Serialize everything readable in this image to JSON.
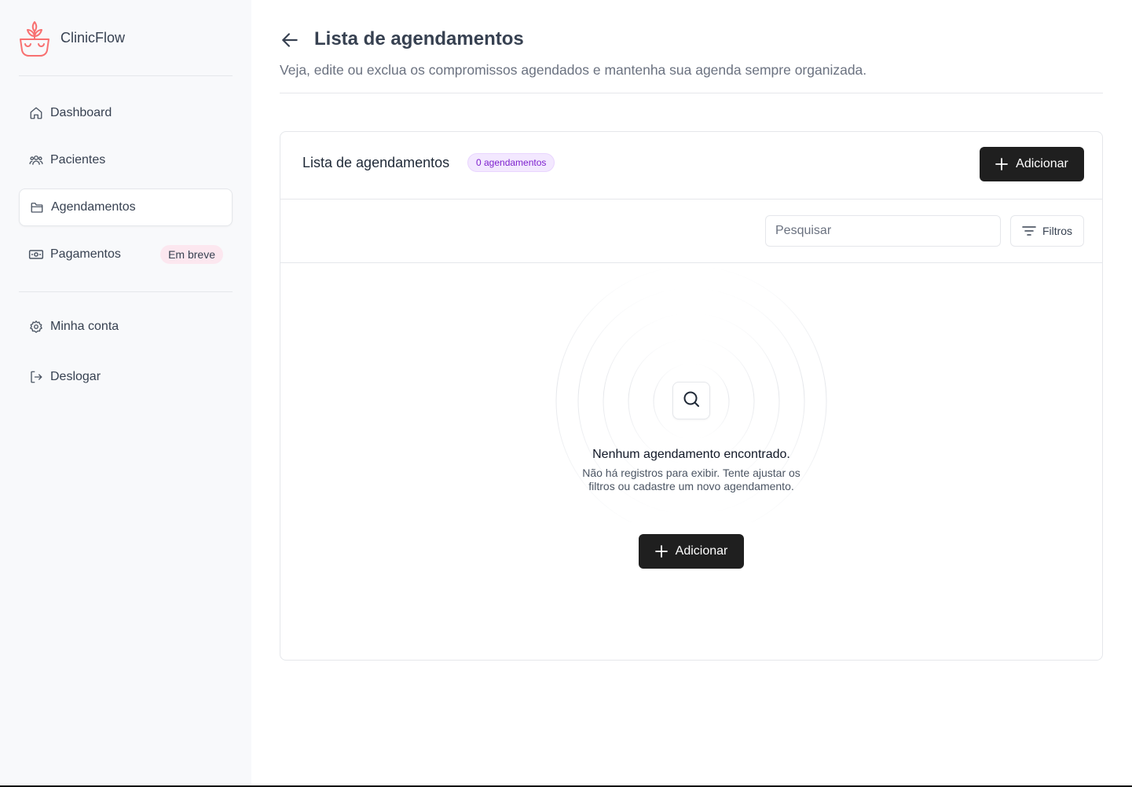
{
  "brand": {
    "name": "ClinicFlow",
    "accent": "#f87171"
  },
  "sidebar": {
    "items": [
      {
        "label": "Dashboard",
        "icon": "home-icon"
      },
      {
        "label": "Pacientes",
        "icon": "users-icon"
      },
      {
        "label": "Agendamentos",
        "icon": "folder-icon",
        "active": true
      },
      {
        "label": "Pagamentos",
        "icon": "banknote-icon",
        "badge": "Em breve"
      }
    ],
    "account_items": [
      {
        "label": "Minha conta",
        "icon": "gear-icon"
      },
      {
        "label": "Deslogar",
        "icon": "logout-icon"
      }
    ]
  },
  "header": {
    "title": "Lista de agendamentos",
    "subtitle": "Veja, edite ou exclua os compromissos agendados e mantenha sua agenda sempre organizada."
  },
  "card": {
    "title": "Lista de agendamentos",
    "count_badge": "0 agendamentos",
    "add_label": "Adicionar"
  },
  "toolbar": {
    "search_placeholder": "Pesquisar",
    "search_value": "",
    "filters_label": "Filtros"
  },
  "empty_state": {
    "title": "Nenhum agendamento encontrado.",
    "description": "Não há registros para exibir. Tente ajustar os filtros ou cadastre um novo agendamento.",
    "add_label": "Adicionar"
  }
}
